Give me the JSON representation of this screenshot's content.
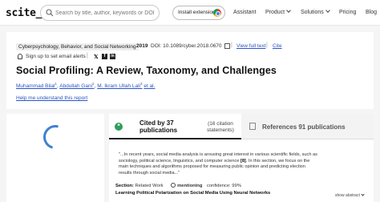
{
  "nav": {
    "logo": "scite_",
    "search_placeholder": "Search by title, author, keywords or DOI",
    "install_label": "Install extension",
    "links": [
      {
        "label": "Assistant",
        "dropdown": false
      },
      {
        "label": "Product",
        "dropdown": true
      },
      {
        "label": "Solutions",
        "dropdown": true
      },
      {
        "label": "Pricing",
        "dropdown": false
      },
      {
        "label": "Blog",
        "dropdown": false
      }
    ]
  },
  "paper": {
    "journal": "Cyberpsychology, Behavior, and Social Networking",
    "year": "2019",
    "doi": "DOI: 10.1089/cyber.2018.0670",
    "view_full_text": "View full text",
    "cite": "Cite",
    "alerts": "Sign up to set email alerts",
    "title": "Social Profiling: A Review, Taxonomy, and Challenges",
    "authors": [
      {
        "name": "Muhammad Bilal",
        "sup": "1"
      },
      {
        "name": "Abdullah Gani",
        "sup": "2"
      },
      {
        "name": "M. Ikram Ullah Lali",
        "sup": "3"
      }
    ],
    "et_al": "et al.",
    "help_link": "Help me understand this report"
  },
  "citations": {
    "cited_by": "Cited by 37 publications",
    "statements": "(16 citation statements)",
    "references": "References 91 publications",
    "snippet_pre": "\"...In recent years, social media analysis is arousing great interest in various scientific fields, such as sociology, political science, linguistics, and computer science",
    "snippet_ref": "[8]",
    "snippet_post": ". In this section, we focus on the main techniques and algorithms proposed for measuring public opinion and predicting election results through social media...\"",
    "section_label": "Section:",
    "section_value": "Related Work",
    "mention_label": "mentioning",
    "confidence": "confidence: 99%",
    "citing_title": "Learning Political Polarization on Social Media Using Neural Networks",
    "show_abstract": "show abstract"
  }
}
